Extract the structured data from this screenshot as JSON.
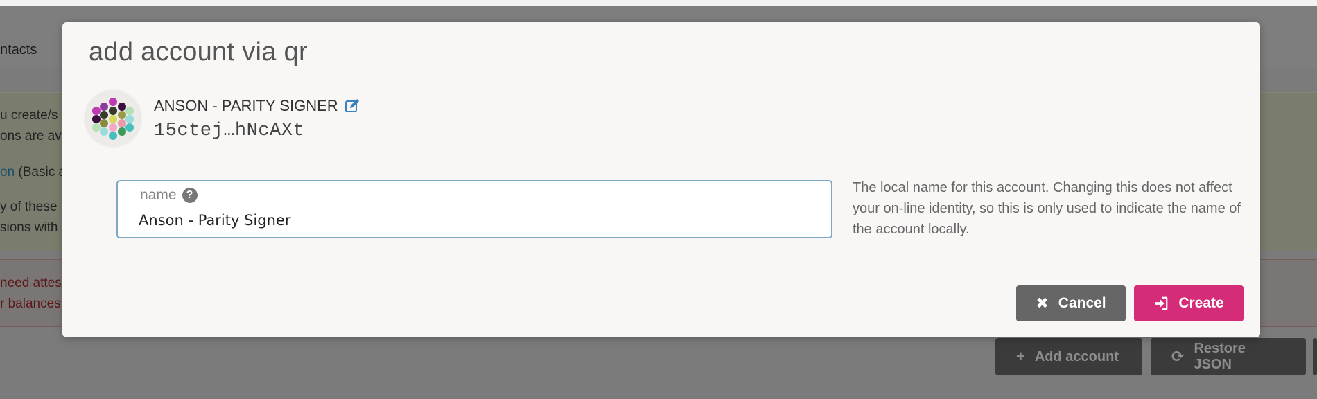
{
  "background": {
    "tab_label": "ntacts",
    "notice_lines": [
      "u create/s",
      "ons are av",
      "(Basic a",
      "y of these",
      "sions with"
    ],
    "notice_link": "on",
    "warning_lines": [
      "need attes",
      "r balances"
    ],
    "buttons": {
      "add_account_label": "Add account",
      "restore_json_label": "Restore JSON"
    }
  },
  "modal": {
    "title": "add account via qr",
    "account": {
      "name": "ANSON - PARITY SIGNER",
      "address": "15ctej…hNcAXt"
    },
    "name_field": {
      "label": "name",
      "value": "Anson - Parity Signer",
      "help": "The local name for this account. Changing this does not affect your on-line identity, so this is only used to indicate the name of the account locally."
    },
    "buttons": {
      "cancel_label": "Cancel",
      "create_label": "Create"
    }
  },
  "colors": {
    "accent_create": "#d52c7a",
    "cancel_gray": "#666666",
    "field_border": "#7da8c6"
  },
  "icons": {
    "edit": "edit-icon",
    "help": "question-circle-icon",
    "cancel": "x-icon",
    "create": "sign-in-icon",
    "add": "plus-icon",
    "restore": "sync-icon"
  }
}
